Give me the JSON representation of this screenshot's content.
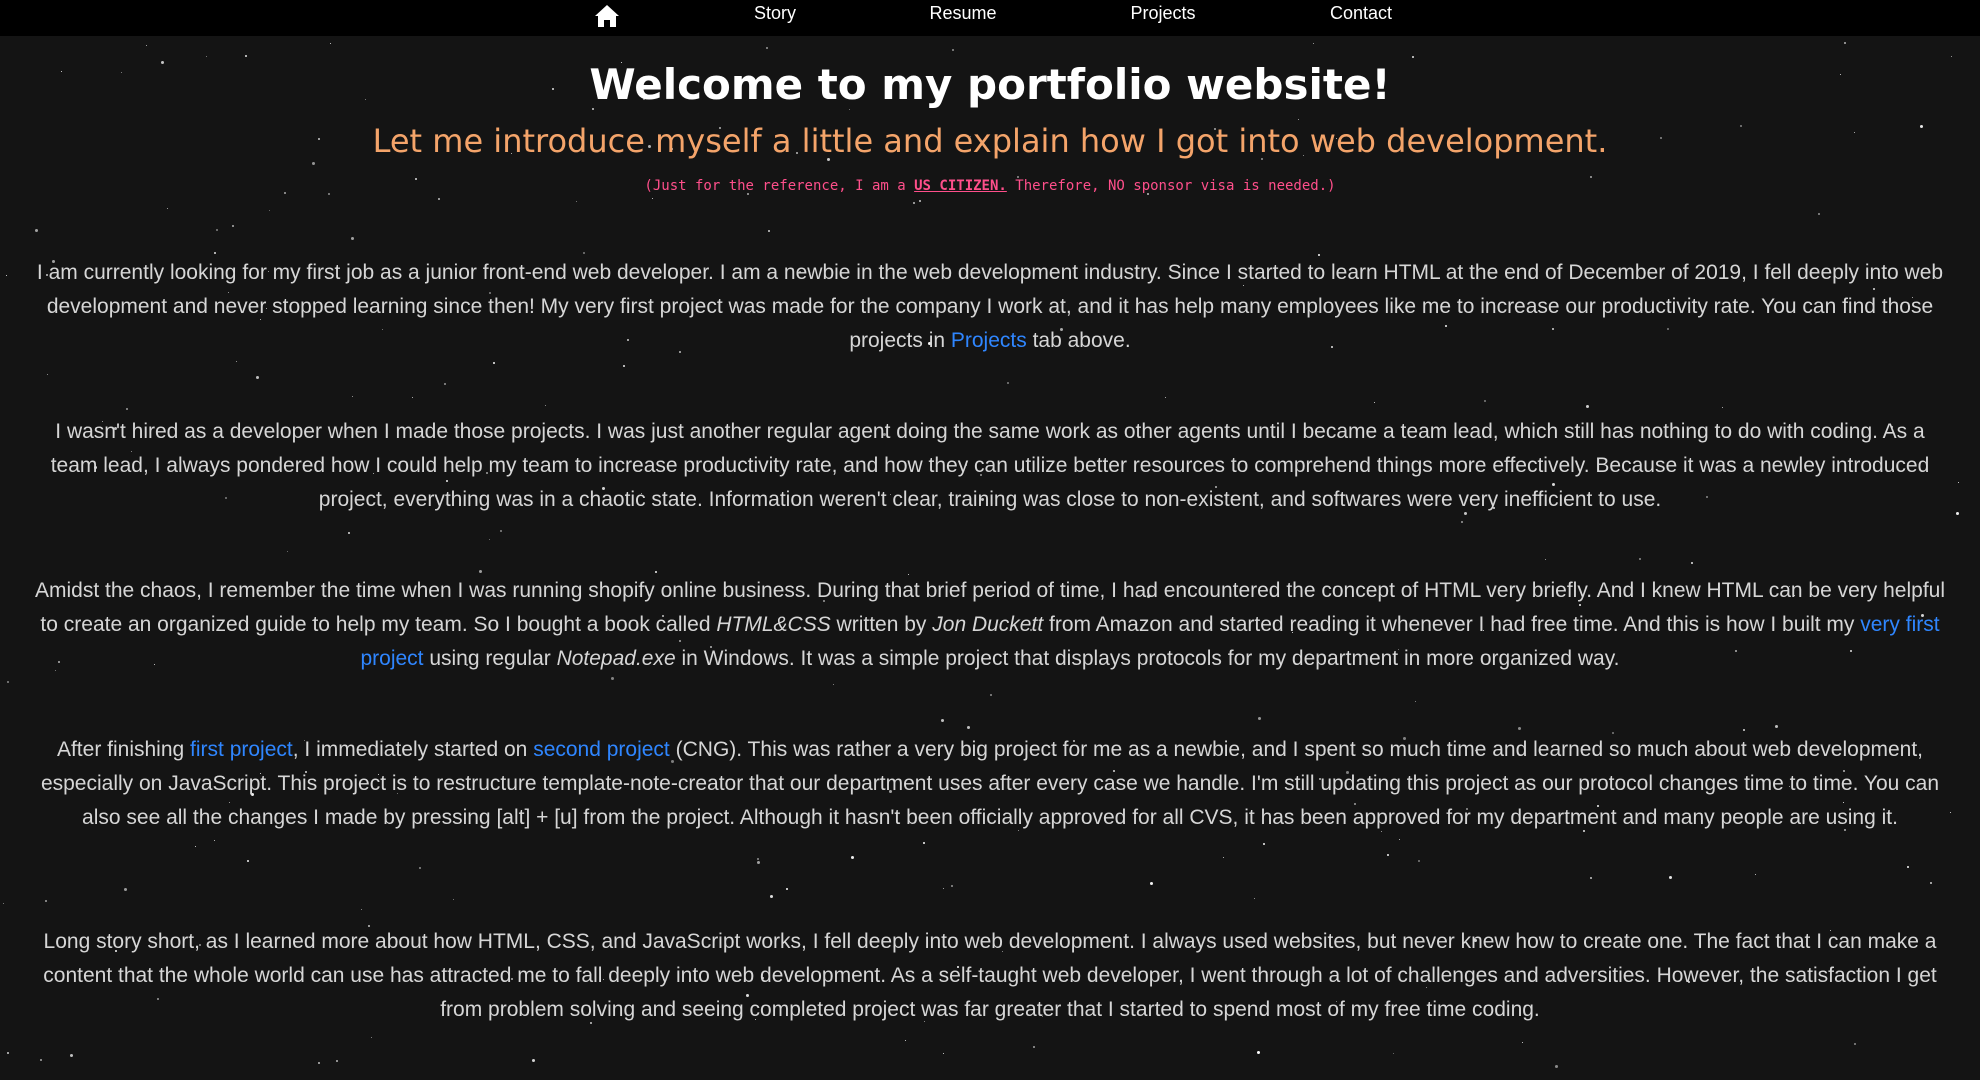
{
  "nav": {
    "home_icon": "home-icon",
    "links": [
      "Story",
      "Resume",
      "Projects",
      "Contact"
    ]
  },
  "header": {
    "title": "Welcome to my portfolio website!",
    "subtitle": "Let me introduce myself a little and explain how I got into web development.",
    "note_prefix": "(Just for the reference, I am a ",
    "note_emphasis": "US CITIZEN.",
    "note_suffix": " Therefore, NO sponsor visa is needed.)"
  },
  "paragraphs": {
    "p1": {
      "text1": "I am currently looking for my first job as a junior front-end web developer. I am a newbie in the web development industry. Since I started to learn HTML at the end of December of 2019, I fell deeply into web development and never stopped learning since then! My very first project was made for the company I work at, and it has help many employees like me to increase our productivity rate. You can find those projects in ",
      "link1": "Projects",
      "text2": " tab above."
    },
    "p2": {
      "text1": "I wasn't hired as a developer when I made those projects. I was just another regular agent doing the same work as other agents until I became a team lead, which still has nothing to do with coding. As a team lead, I always pondered how I could help my team to increase productivity rate, and how they can utilize better resources to comprehend things more effectively. Because it was a newley introduced project, everything was in a chaotic state. Information weren't clear, training was close to non-existent, and softwares were very inefficient to use."
    },
    "p3": {
      "text1": "Amidst the chaos, I remember the time when I was running shopify online business. During that brief period of time, I had encountered the concept of HTML very briefly. And I knew HTML can be very helpful to create an organized guide to help my team. So I bought a book called ",
      "italic1": "HTML&CSS",
      "text2": " written by ",
      "italic2": "Jon Duckett",
      "text3": " from Amazon and started reading it whenever I had free time. And this is how I built my ",
      "link1": "very first project",
      "text4": " using regular ",
      "italic3": "Notepad.exe",
      "text5": " in Windows. It was a simple project that displays protocols for my department in more organized way."
    },
    "p4": {
      "text1": "After finishing ",
      "link1": "first project",
      "text2": ", I immediately started on ",
      "link2": "second project",
      "text3": " (CNG). This was rather a very big project for me as a newbie, and I spent so much time and learned so much about web development, especially on JavaScript. This project is to restructure template-note-creator that our department uses after every case we handle. I'm still updating this project as our protocol changes time to time. You can also see all the changes I made by pressing [alt] + [u] from the project. Although it hasn't been officially approved for all CVS, it has been approved for my department and many people are using it."
    },
    "p5": {
      "text1": "Long story short, as I learned more about how HTML, CSS, and JavaScript works, I fell deeply into web development. I always used websites, but never knew how to create one. The fact that I can make a content that the whole world can use has attracted me to fall deeply into web development. As a self-taught web developer, I went through a lot of challenges and adversities. However, the satisfaction I get from problem solving and seeing completed project was far greater that I started to spend most of my free time coding."
    }
  },
  "colors": {
    "background": "#141414",
    "nav_background": "#000000",
    "subtitle": "#f4a46a",
    "note": "#ff4f8b",
    "link": "#2f86ff"
  }
}
